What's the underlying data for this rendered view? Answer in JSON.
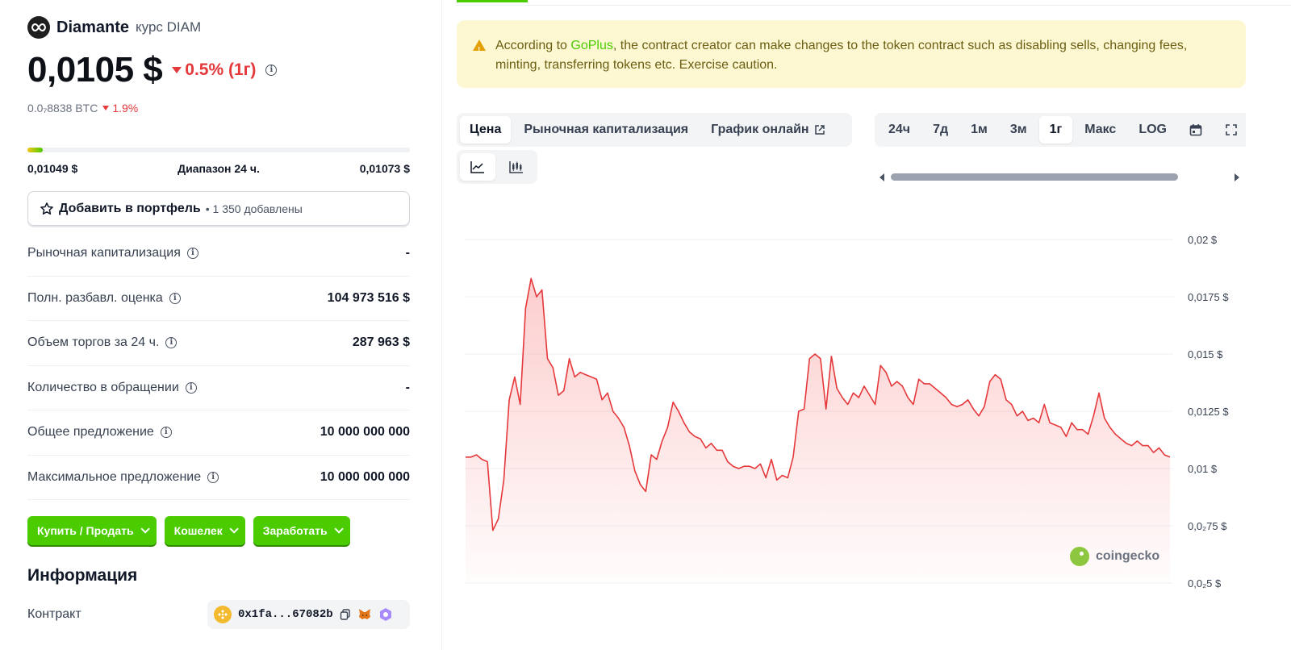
{
  "coin": {
    "name": "Diamante",
    "subtitle": "курс DIAM",
    "price": "0,0105 $",
    "change_1y": "0.5% (1г)",
    "btc_price": "0.0₇8838 BTC",
    "btc_change": "1.9%",
    "range_low": "0,01049 $",
    "range_label": "Диапазон 24 ч.",
    "range_high": "0,01073 $",
    "range_fill_fraction": 0.04
  },
  "portfolio": {
    "label": "Добавить в портфель",
    "count": "• 1 350 добавлены"
  },
  "stats": [
    {
      "label": "Рыночная капитализация",
      "value": "-"
    },
    {
      "label": "Полн. разбавл. оценка",
      "value": "104 973 516 $"
    },
    {
      "label": "Объем торгов за 24 ч.",
      "value": "287 963 $"
    },
    {
      "label": "Количество в обращении",
      "value": "-"
    },
    {
      "label": "Общее предложение",
      "value": "10 000 000 000"
    },
    {
      "label": "Максимальное предложение",
      "value": "10 000 000 000"
    }
  ],
  "actions": {
    "buy_sell": "Купить / Продать",
    "wallet": "Кошелек",
    "earn": "Заработать"
  },
  "info": {
    "title": "Информация",
    "contract_label": "Контракт",
    "contract_address": "0x1fa...67082b"
  },
  "warning": {
    "prefix": "According to ",
    "link": "GoPlus",
    "suffix": ", the contract creator can make changes to the token contract such as disabling sells, changing fees, minting, transferring tokens etc. Exercise caution."
  },
  "chart_tabs": {
    "price": "Цена",
    "market_cap": "Рыночная капитализация",
    "live_chart": "График онлайн"
  },
  "range_tabs": [
    "24ч",
    "7д",
    "1м",
    "3м",
    "1г",
    "Макс",
    "LOG"
  ],
  "active_range": "1г",
  "colors": {
    "accent_green": "#4bcc00",
    "down_red": "#e5383b",
    "warning_bg": "#fdf8d2"
  },
  "watermark": "coingecko",
  "chart_data": {
    "type": "area",
    "ylim": [
      0.005,
      0.02
    ],
    "yticks": [
      {
        "value": 0.02,
        "label": "0,02 $"
      },
      {
        "value": 0.0175,
        "label": "0,0175 $"
      },
      {
        "value": 0.015,
        "label": "0,015 $"
      },
      {
        "value": 0.0125,
        "label": "0,0125 $"
      },
      {
        "value": 0.01,
        "label": "0,01 $"
      },
      {
        "value": 0.0075,
        "label": "0,0₂75 $"
      },
      {
        "value": 0.005,
        "label": "0,0₂5 $"
      }
    ],
    "series": [
      {
        "values": [
          0.0105,
          0.0105,
          0.0106,
          0.0104,
          0.0103,
          0.0073,
          0.0078,
          0.0095,
          0.013,
          0.014,
          0.0128,
          0.017,
          0.0183,
          0.0175,
          0.0178,
          0.0148,
          0.0144,
          0.0132,
          0.0134,
          0.0148,
          0.014,
          0.0142,
          0.0141,
          0.014,
          0.0139,
          0.013,
          0.0133,
          0.0125,
          0.0122,
          0.0118,
          0.011,
          0.0099,
          0.0093,
          0.009,
          0.0106,
          0.0104,
          0.0112,
          0.0118,
          0.0129,
          0.0125,
          0.012,
          0.0116,
          0.0114,
          0.0113,
          0.0109,
          0.0111,
          0.0108,
          0.0108,
          0.0103,
          0.0101,
          0.01,
          0.0101,
          0.0101,
          0.01,
          0.0102,
          0.0096,
          0.0104,
          0.0095,
          0.0097,
          0.0096,
          0.0105,
          0.0125,
          0.0126,
          0.0148,
          0.015,
          0.0148,
          0.0126,
          0.0149,
          0.0135,
          0.0131,
          0.0128,
          0.0133,
          0.0131,
          0.0136,
          0.0132,
          0.0128,
          0.0145,
          0.0142,
          0.0136,
          0.0138,
          0.0136,
          0.0131,
          0.0128,
          0.0139,
          0.0137,
          0.0137,
          0.0135,
          0.0133,
          0.0131,
          0.0128,
          0.0127,
          0.0128,
          0.013,
          0.0126,
          0.0123,
          0.0127,
          0.0138,
          0.0141,
          0.0139,
          0.013,
          0.0128,
          0.0123,
          0.0125,
          0.0121,
          0.0122,
          0.012,
          0.0128,
          0.012,
          0.0119,
          0.0118,
          0.0114,
          0.012,
          0.0117,
          0.0117,
          0.0115,
          0.0123,
          0.0133,
          0.0122,
          0.0118,
          0.0115,
          0.0113,
          0.0111,
          0.011,
          0.0112,
          0.011,
          0.011,
          0.0107,
          0.0109,
          0.0106,
          0.0105
        ]
      }
    ]
  }
}
